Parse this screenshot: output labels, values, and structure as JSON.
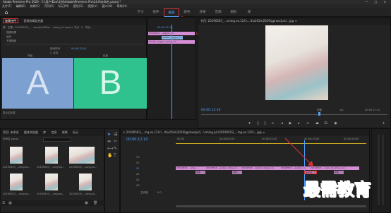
{
  "window": {
    "title": "Adobe Premiere Pro 2020 - C:\\用户\\Ebo\\文档\\Adobe\\Premiere Pro\\14.0\\未命名.prproj *",
    "controls": "— □ ×"
  },
  "menu": [
    "文件(F)",
    "编辑(E)",
    "剪辑(C)",
    "序列(S)",
    "标记(M)",
    "图形(G)",
    "视图(V)",
    "窗口(W)",
    "帮助(H)"
  ],
  "workspaces": [
    "学习",
    "组件",
    "编辑",
    "颜色",
    "效果",
    "音频",
    "图形",
    "库"
  ],
  "active_workspace": "编辑",
  "source_panel": {
    "tabs": [
      "效果控件",
      "音频剪辑混合器"
    ],
    "active_tab": "效果控件",
    "clip_path": "源 · 主要 \\ 20190503_...  ·  sion\\t\\u202e\\... shing_01.mp4 > 节点 · 4 · 节点...",
    "row1_label": "视频效果",
    "row2_label": "运动",
    "row3_label": "不透明度",
    "time1": "00:00:12:10",
    "time2": "00:00:12:10",
    "row_a_label": "持续时间",
    "row_b_label": "□ 反向",
    "label_a": "A",
    "label_b": "B",
    "head_a": "开始",
    "head_b": "结束",
    "footer": "显示实际源"
  },
  "mini_timeline": {
    "clips": [
      "20190503_...jpg[pic_cl...",
      "3008e...jpg[pic_cl...",
      "20190...jpg[pic_shing_cut..."
    ],
    "time": "00:00:12:10"
  },
  "program_monitor": {
    "tab": "节目: 20190503_...sming.ex.124.\\...\\t\\u202e\\2019\\gproxx\\pic\\...jpg ≡",
    "timecode": "00:00:12:10",
    "zoom": "完整",
    "fraction": "1/2",
    "duration": "00:00:17:12"
  },
  "project_panel": {
    "tabs": [
      "项目: 未命名",
      "媒体浏览器",
      "库",
      "信息",
      "效果",
      "标记"
    ],
    "project_name": "未命名.prproj",
    "items": [
      {
        "name": "20190503_...umg.ex...",
        "dur": "5:00"
      },
      {
        "name": "20190503_...umg.ex...",
        "dur": "5:00"
      },
      {
        "name": "20190503_...umg.ex...",
        "dur": "5:00"
      },
      {
        "name": "20190503_...umg.ex...",
        "dur": "5:00"
      },
      {
        "name": "20190503_...umg.ex...",
        "dur": "5:00"
      },
      {
        "name": "20190503_...umg.ex...",
        "dur": "5:00"
      }
    ]
  },
  "timeline": {
    "tab": "× 20190503_...mg.ex.124.\\...\\t\\u202e\\2019\\gproxx\\pic\\...\\sming.pic\\20190503_...mg.ex.124.\\...jpg ≡",
    "timecode": "00:00:12:10",
    "ruler": [
      "00:00",
      "00:00:05:00",
      "00:00:10:00",
      "00:00:15:00",
      "00:00:20:00"
    ],
    "tracks": [
      "V3",
      "V2",
      "V1",
      "A1",
      "A2",
      "A3"
    ],
    "master": "主声道",
    "master_val": "0.0",
    "v1_clips": [
      "20190503_...umg...",
      "20190503_...pic[pic_shing_cl...",
      "20190503_...pic[pic_shing_cut...",
      "20190503_...pic[pic_cl...",
      "20190503_...ncpic_qt_shing_cut..."
    ],
    "v1_labels": [
      "渐变",
      "渐变",
      "交叉溶",
      "渐变"
    ]
  },
  "watermark": "最需教育"
}
